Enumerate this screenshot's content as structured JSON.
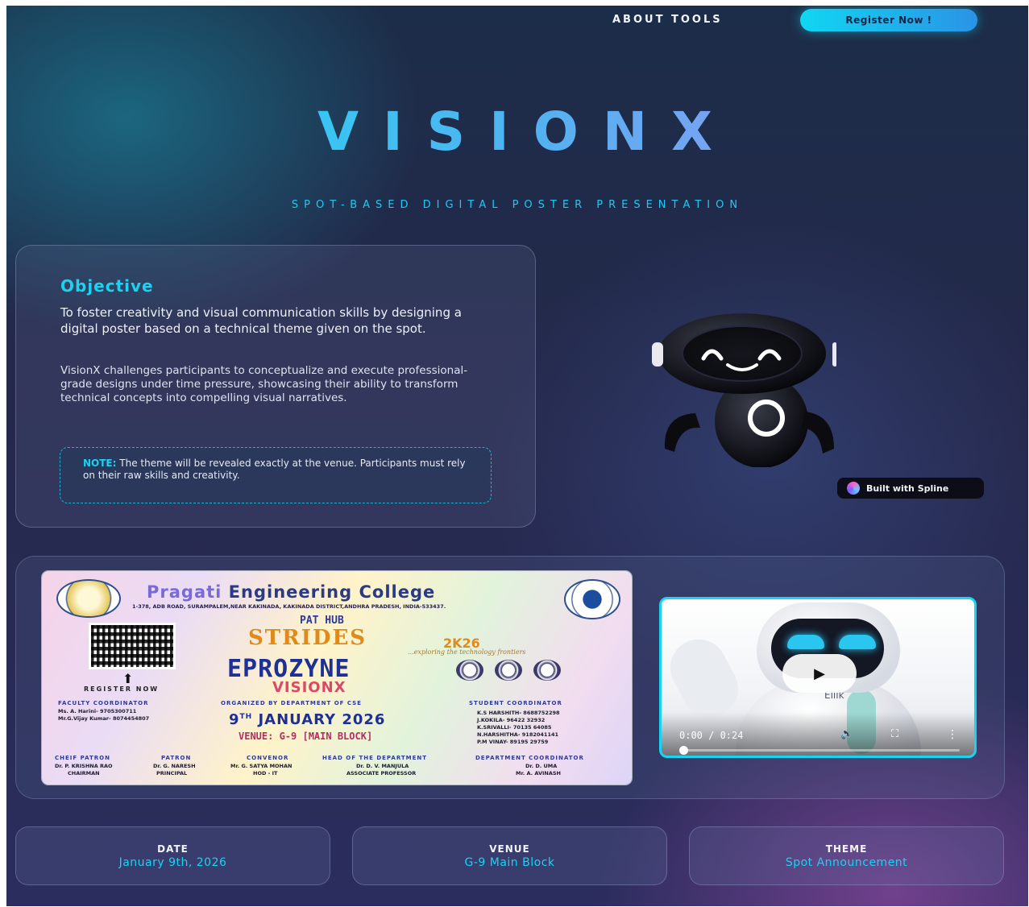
{
  "nav": {
    "about_tools": "ABOUT TOOLS",
    "register": "Register Now !"
  },
  "hero": {
    "title": "VISIONX",
    "subtitle": "SPOT-BASED DIGITAL POSTER PRESENTATION"
  },
  "objective": {
    "heading": "Objective",
    "paragraph1": "To foster creativity and visual communication skills by designing a digital poster based on a technical theme given on the spot.",
    "paragraph2": "VisionX challenges participants to conceptualize and execute professional-grade designs under time pressure, showcasing their ability to transform technical concepts into compelling visual narratives.",
    "note_label": "NOTE:",
    "note_text": " The theme will be revealed exactly at the venue. Participants must rely on their raw skills and creativity."
  },
  "spline_badge": "Built with Spline",
  "poster": {
    "college_first": "Pragati",
    "college_rest": " Engineering College",
    "address": "1-378, ADB ROAD, SURAMPALEM,NEAR KAKINADA, KAKINADA DISTRICT,ANDHRA PRADESH, INDIA-533437.",
    "pat_hub": "PAT HUB",
    "strides": "STRIDES",
    "strides_year": "2K26",
    "tagline": "...exploring the technology frontiers",
    "register_now": "REGISTER NOW",
    "eprozyne": "EPROZYNE",
    "visionx": "VISIONX",
    "faculty_label": "FACULTY COORDINATOR",
    "faculty_1": "Ms. A. Harini- 9705300711",
    "faculty_2": "Mr.G.Vijay Kumar- 8074454807",
    "organized": "ORGANIZED BY DEPARTMENT OF CSE",
    "date_day": "9",
    "date_sup": "TH",
    "date_rest": " JANUARY 2026",
    "venue": "VENUE: G-9 [MAIN BLOCK]",
    "student_label": "STUDENT COORDINATOR",
    "student_1": "K.S HARSHITH- 8688752298",
    "student_2": "J.KOKILA- 96422 32932",
    "student_3": "K.SRIVALLI- 70135 64085",
    "student_4": "N.HARSHITHA- 9182041141",
    "student_5": "P.M VINAY- 89195 29759",
    "chief_patron_label": "CHEIF PATRON",
    "chief_patron_name": "Dr. P. KRISHNA RAO",
    "chief_patron_role": "CHAIRMAN",
    "patron_label": "PATRON",
    "patron_name": "Dr. G. NARESH",
    "patron_role": "PRINCIPAL",
    "convenor_label": "CONVENOR",
    "convenor_name": "Mr. G. SATYA MOHAN",
    "convenor_role": "HOD - IT",
    "hod_label": "HEAD OF THE DEPARTMENT",
    "hod_name": "Dr. D. V. MANJULA",
    "hod_role": "ASSOCIATE PROFESSOR",
    "dept_coord_label": "DEPARTMENT COORDINATOR",
    "dept_coord_name_1": "Dr. D. UMA",
    "dept_coord_name_2": "Mr. A. AVINASH"
  },
  "video": {
    "time": "0:00 / 0:24",
    "brand": "Eilik",
    "progress": 0.0
  },
  "info": {
    "date_label": "DATE",
    "date_value": "January 9th, 2026",
    "venue_label": "VENUE",
    "venue_value": "G-9 Main Block",
    "theme_label": "THEME",
    "theme_value": "Spot Announcement"
  },
  "colors": {
    "accent": "#19d3f0",
    "button": "#11d6f2",
    "background": "#25284b"
  }
}
